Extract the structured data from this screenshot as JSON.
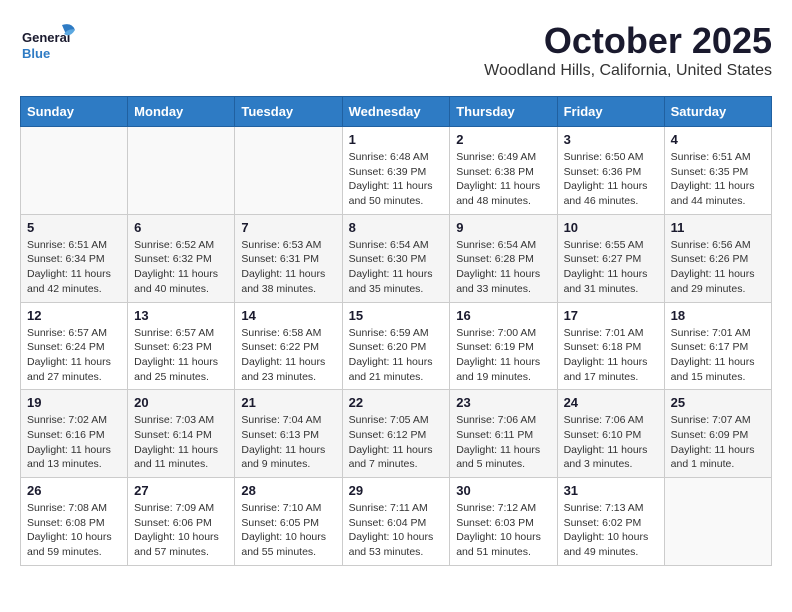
{
  "header": {
    "logo_general": "General",
    "logo_blue": "Blue",
    "month": "October 2025",
    "location": "Woodland Hills, California, United States"
  },
  "weekdays": [
    "Sunday",
    "Monday",
    "Tuesday",
    "Wednesday",
    "Thursday",
    "Friday",
    "Saturday"
  ],
  "weeks": [
    [
      {
        "day": "",
        "info": ""
      },
      {
        "day": "",
        "info": ""
      },
      {
        "day": "",
        "info": ""
      },
      {
        "day": "1",
        "info": "Sunrise: 6:48 AM\nSunset: 6:39 PM\nDaylight: 11 hours\nand 50 minutes."
      },
      {
        "day": "2",
        "info": "Sunrise: 6:49 AM\nSunset: 6:38 PM\nDaylight: 11 hours\nand 48 minutes."
      },
      {
        "day": "3",
        "info": "Sunrise: 6:50 AM\nSunset: 6:36 PM\nDaylight: 11 hours\nand 46 minutes."
      },
      {
        "day": "4",
        "info": "Sunrise: 6:51 AM\nSunset: 6:35 PM\nDaylight: 11 hours\nand 44 minutes."
      }
    ],
    [
      {
        "day": "5",
        "info": "Sunrise: 6:51 AM\nSunset: 6:34 PM\nDaylight: 11 hours\nand 42 minutes."
      },
      {
        "day": "6",
        "info": "Sunrise: 6:52 AM\nSunset: 6:32 PM\nDaylight: 11 hours\nand 40 minutes."
      },
      {
        "day": "7",
        "info": "Sunrise: 6:53 AM\nSunset: 6:31 PM\nDaylight: 11 hours\nand 38 minutes."
      },
      {
        "day": "8",
        "info": "Sunrise: 6:54 AM\nSunset: 6:30 PM\nDaylight: 11 hours\nand 35 minutes."
      },
      {
        "day": "9",
        "info": "Sunrise: 6:54 AM\nSunset: 6:28 PM\nDaylight: 11 hours\nand 33 minutes."
      },
      {
        "day": "10",
        "info": "Sunrise: 6:55 AM\nSunset: 6:27 PM\nDaylight: 11 hours\nand 31 minutes."
      },
      {
        "day": "11",
        "info": "Sunrise: 6:56 AM\nSunset: 6:26 PM\nDaylight: 11 hours\nand 29 minutes."
      }
    ],
    [
      {
        "day": "12",
        "info": "Sunrise: 6:57 AM\nSunset: 6:24 PM\nDaylight: 11 hours\nand 27 minutes."
      },
      {
        "day": "13",
        "info": "Sunrise: 6:57 AM\nSunset: 6:23 PM\nDaylight: 11 hours\nand 25 minutes."
      },
      {
        "day": "14",
        "info": "Sunrise: 6:58 AM\nSunset: 6:22 PM\nDaylight: 11 hours\nand 23 minutes."
      },
      {
        "day": "15",
        "info": "Sunrise: 6:59 AM\nSunset: 6:20 PM\nDaylight: 11 hours\nand 21 minutes."
      },
      {
        "day": "16",
        "info": "Sunrise: 7:00 AM\nSunset: 6:19 PM\nDaylight: 11 hours\nand 19 minutes."
      },
      {
        "day": "17",
        "info": "Sunrise: 7:01 AM\nSunset: 6:18 PM\nDaylight: 11 hours\nand 17 minutes."
      },
      {
        "day": "18",
        "info": "Sunrise: 7:01 AM\nSunset: 6:17 PM\nDaylight: 11 hours\nand 15 minutes."
      }
    ],
    [
      {
        "day": "19",
        "info": "Sunrise: 7:02 AM\nSunset: 6:16 PM\nDaylight: 11 hours\nand 13 minutes."
      },
      {
        "day": "20",
        "info": "Sunrise: 7:03 AM\nSunset: 6:14 PM\nDaylight: 11 hours\nand 11 minutes."
      },
      {
        "day": "21",
        "info": "Sunrise: 7:04 AM\nSunset: 6:13 PM\nDaylight: 11 hours\nand 9 minutes."
      },
      {
        "day": "22",
        "info": "Sunrise: 7:05 AM\nSunset: 6:12 PM\nDaylight: 11 hours\nand 7 minutes."
      },
      {
        "day": "23",
        "info": "Sunrise: 7:06 AM\nSunset: 6:11 PM\nDaylight: 11 hours\nand 5 minutes."
      },
      {
        "day": "24",
        "info": "Sunrise: 7:06 AM\nSunset: 6:10 PM\nDaylight: 11 hours\nand 3 minutes."
      },
      {
        "day": "25",
        "info": "Sunrise: 7:07 AM\nSunset: 6:09 PM\nDaylight: 11 hours\nand 1 minute."
      }
    ],
    [
      {
        "day": "26",
        "info": "Sunrise: 7:08 AM\nSunset: 6:08 PM\nDaylight: 10 hours\nand 59 minutes."
      },
      {
        "day": "27",
        "info": "Sunrise: 7:09 AM\nSunset: 6:06 PM\nDaylight: 10 hours\nand 57 minutes."
      },
      {
        "day": "28",
        "info": "Sunrise: 7:10 AM\nSunset: 6:05 PM\nDaylight: 10 hours\nand 55 minutes."
      },
      {
        "day": "29",
        "info": "Sunrise: 7:11 AM\nSunset: 6:04 PM\nDaylight: 10 hours\nand 53 minutes."
      },
      {
        "day": "30",
        "info": "Sunrise: 7:12 AM\nSunset: 6:03 PM\nDaylight: 10 hours\nand 51 minutes."
      },
      {
        "day": "31",
        "info": "Sunrise: 7:13 AM\nSunset: 6:02 PM\nDaylight: 10 hours\nand 49 minutes."
      },
      {
        "day": "",
        "info": ""
      }
    ]
  ]
}
